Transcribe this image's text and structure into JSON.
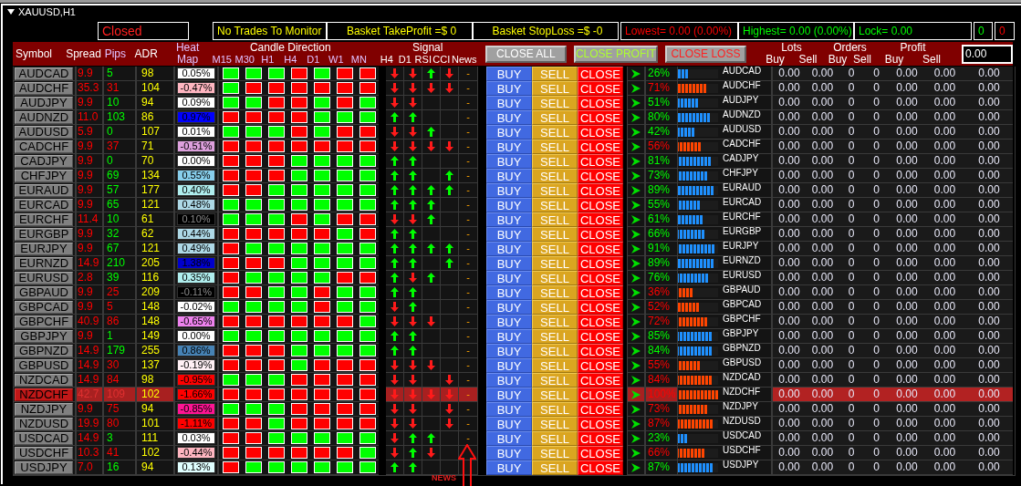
{
  "window": {
    "title": "XAUUSD,H1"
  },
  "status": {
    "state": "Closed",
    "monitor": "No Trades To Monitor",
    "basket_take_profit": "Basket TakeProfit =$ 0",
    "basket_stop_loss": "Basket StopLoss =$ -0",
    "lowest": "Lowest= 0.00 (0.00%)",
    "highest": "Highest= 0.00 (0.00%)",
    "lock": "Lock= 0.00",
    "buy_count": "0",
    "sell_count": "0"
  },
  "header": {
    "symbol": "Symbol",
    "spread": "Spread",
    "pips": "Pips",
    "adr": "ADR",
    "heat_map": "Heat Map",
    "candle_direction": {
      "title": "Candle Direction",
      "timeframes": [
        "M15",
        "M30",
        "H1",
        "H4",
        "D1",
        "W1",
        "MN"
      ]
    },
    "signal": {
      "title": "Signal",
      "columns": [
        "H4",
        "D1",
        "RSI",
        "CCI",
        "News"
      ]
    },
    "buttons": [
      {
        "label": "CLOSE ALL",
        "kind": "all"
      },
      {
        "label": "CLOSE PROFIT",
        "kind": "profit"
      },
      {
        "label": "CLOSE LOSS",
        "kind": "loss"
      }
    ],
    "groups": [
      {
        "title": "Lots",
        "columns": [
          "Buy",
          "Sell"
        ]
      },
      {
        "title": "Orders",
        "columns": [
          "Buy",
          "Sell"
        ]
      },
      {
        "title": "Profit",
        "columns": [
          "Buy",
          "Sell"
        ]
      }
    ],
    "total_field": {
      "value": "0.00"
    }
  },
  "rows": [
    {
      "symbol": "AUDCAD",
      "selected": false,
      "spread": "9.9",
      "pips": "5",
      "pips_up": true,
      "adr": "98",
      "heat": {
        "text": "0.05%",
        "color": "#ffffff"
      },
      "candles_up": [
        true,
        true,
        true,
        false,
        true,
        false,
        false
      ],
      "signals": [
        {
          "kind": "down"
        },
        {
          "kind": "down"
        },
        {
          "kind": "up"
        },
        {
          "kind": "down"
        }
      ],
      "news": "-",
      "actions": [
        "BUY",
        "SELL",
        "CLOSE"
      ],
      "strength": "26%",
      "level": 0.26,
      "bullish": true,
      "pair": "AUDCAD",
      "values": [
        "0.00",
        "0.00",
        "0",
        "0",
        "0.00",
        "0.00",
        "0.00"
      ]
    },
    {
      "symbol": "AUDCHF",
      "selected": false,
      "spread": "35.3",
      "pips": "31",
      "pips_up": false,
      "adr": "104",
      "heat": {
        "text": "-0.47%",
        "color": "#ffb6c1"
      },
      "candles_up": [
        true,
        false,
        false,
        false,
        false,
        false,
        false
      ],
      "signals": [
        {
          "kind": "down"
        },
        {
          "kind": "down"
        },
        {
          "kind": "down"
        },
        {
          "kind": "down"
        }
      ],
      "news": "-",
      "actions": [
        "BUY",
        "SELL",
        "CLOSE"
      ],
      "strength": "71%",
      "level": 0.71,
      "bullish": false,
      "pair": "AUDCHF",
      "values": [
        "0.00",
        "0.00",
        "0",
        "0",
        "0.00",
        "0.00",
        "0.00"
      ]
    },
    {
      "symbol": "AUDJPY",
      "selected": false,
      "spread": "9.9",
      "pips": "10",
      "pips_up": true,
      "adr": "94",
      "heat": {
        "text": "0.09%",
        "color": "#ffffff"
      },
      "candles_up": [
        true,
        true,
        false,
        false,
        true,
        false,
        true
      ],
      "signals": [
        {
          "kind": "down"
        },
        {
          "kind": "down"
        },
        {
          "kind": "blank"
        },
        {
          "kind": "blank"
        }
      ],
      "news": "-",
      "actions": [
        "BUY",
        "SELL",
        "CLOSE"
      ],
      "strength": "51%",
      "level": 0.51,
      "bullish": true,
      "pair": "AUDJPY",
      "values": [
        "0.00",
        "0.00",
        "0",
        "0",
        "0.00",
        "0.00",
        "0.00"
      ]
    },
    {
      "symbol": "AUDNZD",
      "selected": false,
      "spread": "11.0",
      "pips": "103",
      "pips_up": true,
      "adr": "86",
      "heat": {
        "text": "0.97%",
        "color": "#0000ff"
      },
      "candles_up": [
        false,
        false,
        false,
        false,
        true,
        true,
        true
      ],
      "signals": [
        {
          "kind": "up"
        },
        {
          "kind": "up"
        },
        {
          "kind": "blank"
        },
        {
          "kind": "blank"
        }
      ],
      "news": "-",
      "actions": [
        "BUY",
        "SELL",
        "CLOSE"
      ],
      "strength": "80%",
      "level": 0.8,
      "bullish": true,
      "pair": "AUDNZD",
      "values": [
        "0.00",
        "0.00",
        "0",
        "0",
        "0.00",
        "0.00",
        "0.00"
      ]
    },
    {
      "symbol": "AUDUSD",
      "selected": false,
      "spread": "5.9",
      "pips": "0",
      "pips_up": true,
      "adr": "107",
      "heat": {
        "text": "0.01%",
        "color": "#ffffff"
      },
      "candles_up": [
        true,
        true,
        true,
        false,
        true,
        false,
        false
      ],
      "signals": [
        {
          "kind": "down"
        },
        {
          "kind": "down"
        },
        {
          "kind": "up"
        },
        {
          "kind": "blank"
        }
      ],
      "news": "-",
      "actions": [
        "BUY",
        "SELL",
        "CLOSE"
      ],
      "strength": "42%",
      "level": 0.42,
      "bullish": true,
      "pair": "AUDUSD",
      "values": [
        "0.00",
        "0.00",
        "0",
        "0",
        "0.00",
        "0.00",
        "0.00"
      ]
    },
    {
      "symbol": "CADCHF",
      "selected": false,
      "spread": "9.9",
      "pips": "37",
      "pips_up": false,
      "adr": "71",
      "heat": {
        "text": "-0.51%",
        "color": "#dda0dd"
      },
      "candles_up": [
        false,
        false,
        false,
        false,
        false,
        false,
        false
      ],
      "signals": [
        {
          "kind": "down"
        },
        {
          "kind": "down"
        },
        {
          "kind": "down"
        },
        {
          "kind": "down"
        }
      ],
      "news": "-",
      "actions": [
        "BUY",
        "SELL",
        "CLOSE"
      ],
      "strength": "56%",
      "level": 0.56,
      "bullish": false,
      "pair": "CADCHF",
      "values": [
        "0.00",
        "0.00",
        "0",
        "0",
        "0.00",
        "0.00",
        "0.00"
      ]
    },
    {
      "symbol": "CADJPY",
      "selected": false,
      "spread": "9.9",
      "pips": "0",
      "pips_up": true,
      "adr": "70",
      "heat": {
        "text": "0.00%",
        "color": "#ffffff"
      },
      "candles_up": [
        false,
        false,
        false,
        true,
        true,
        true,
        true
      ],
      "signals": [
        {
          "kind": "up"
        },
        {
          "kind": "up"
        },
        {
          "kind": "blank"
        },
        {
          "kind": "blank"
        }
      ],
      "news": "-",
      "actions": [
        "BUY",
        "SELL",
        "CLOSE"
      ],
      "strength": "81%",
      "level": 0.81,
      "bullish": true,
      "pair": "CADJPY",
      "values": [
        "0.00",
        "0.00",
        "0",
        "0",
        "0.00",
        "0.00",
        "0.00"
      ]
    },
    {
      "symbol": "CHFJPY",
      "selected": false,
      "spread": "9.9",
      "pips": "69",
      "pips_up": true,
      "adr": "134",
      "heat": {
        "text": "0.55%",
        "color": "#87ceeb"
      },
      "candles_up": [
        false,
        false,
        false,
        true,
        true,
        true,
        true
      ],
      "signals": [
        {
          "kind": "up"
        },
        {
          "kind": "up"
        },
        {
          "kind": "blank"
        },
        {
          "kind": "up"
        }
      ],
      "news": "-",
      "actions": [
        "BUY",
        "SELL",
        "CLOSE"
      ],
      "strength": "73%",
      "level": 0.73,
      "bullish": true,
      "pair": "CHFJPY",
      "values": [
        "0.00",
        "0.00",
        "0",
        "0",
        "0.00",
        "0.00",
        "0.00"
      ]
    },
    {
      "symbol": "EURAUD",
      "selected": false,
      "spread": "9.9",
      "pips": "57",
      "pips_up": true,
      "adr": "177",
      "heat": {
        "text": "0.40%",
        "color": "#afeeee"
      },
      "candles_up": [
        false,
        false,
        true,
        true,
        true,
        true,
        true
      ],
      "signals": [
        {
          "kind": "up"
        },
        {
          "kind": "up"
        },
        {
          "kind": "up"
        },
        {
          "kind": "up"
        }
      ],
      "news": "-",
      "actions": [
        "BUY",
        "SELL",
        "CLOSE"
      ],
      "strength": "89%",
      "level": 0.89,
      "bullish": true,
      "pair": "EURAUD",
      "values": [
        "0.00",
        "0.00",
        "0",
        "0",
        "0.00",
        "0.00",
        "0.00"
      ]
    },
    {
      "symbol": "EURCAD",
      "selected": false,
      "spread": "9.9",
      "pips": "65",
      "pips_up": true,
      "adr": "121",
      "heat": {
        "text": "0.48%",
        "color": "#add8e6"
      },
      "candles_up": [
        true,
        true,
        true,
        true,
        true,
        true,
        true
      ],
      "signals": [
        {
          "kind": "up"
        },
        {
          "kind": "up"
        },
        {
          "kind": "up"
        },
        {
          "kind": "blank"
        }
      ],
      "news": "-",
      "actions": [
        "BUY",
        "SELL",
        "CLOSE"
      ],
      "strength": "55%",
      "level": 0.55,
      "bullish": true,
      "pair": "EURCAD",
      "values": [
        "0.00",
        "0.00",
        "0",
        "0",
        "0.00",
        "0.00",
        "0.00"
      ]
    },
    {
      "symbol": "EURCHF",
      "selected": false,
      "spread": "11.4",
      "pips": "10",
      "pips_up": true,
      "adr": "61",
      "heat": {
        "text": "0.10%",
        "color": "#000000"
      },
      "candles_up": [
        true,
        true,
        true,
        false,
        true,
        false,
        false
      ],
      "signals": [
        {
          "kind": "down"
        },
        {
          "kind": "down"
        },
        {
          "kind": "up"
        },
        {
          "kind": "blank"
        }
      ],
      "news": "-",
      "actions": [
        "BUY",
        "SELL",
        "CLOSE"
      ],
      "strength": "61%",
      "level": 0.61,
      "bullish": true,
      "pair": "EURCHF",
      "values": [
        "0.00",
        "0.00",
        "0",
        "0",
        "0.00",
        "0.00",
        "0.00"
      ]
    },
    {
      "symbol": "EURGBP",
      "selected": false,
      "spread": "9.9",
      "pips": "32",
      "pips_up": true,
      "adr": "62",
      "heat": {
        "text": "0.44%",
        "color": "#add8e6"
      },
      "candles_up": [
        false,
        false,
        false,
        false,
        false,
        true,
        false
      ],
      "signals": [
        {
          "kind": "up"
        },
        {
          "kind": "up"
        },
        {
          "kind": "blank"
        },
        {
          "kind": "blank"
        }
      ],
      "news": "-",
      "actions": [
        "BUY",
        "SELL",
        "CLOSE"
      ],
      "strength": "66%",
      "level": 0.66,
      "bullish": true,
      "pair": "EURGBP",
      "values": [
        "0.00",
        "0.00",
        "0",
        "0",
        "0.00",
        "0.00",
        "0.00"
      ]
    },
    {
      "symbol": "EURJPY",
      "selected": false,
      "spread": "9.9",
      "pips": "67",
      "pips_up": true,
      "adr": "121",
      "heat": {
        "text": "0.49%",
        "color": "#add8e6"
      },
      "candles_up": [
        false,
        true,
        true,
        true,
        true,
        true,
        true
      ],
      "signals": [
        {
          "kind": "up"
        },
        {
          "kind": "up"
        },
        {
          "kind": "up"
        },
        {
          "kind": "up"
        }
      ],
      "news": "-",
      "actions": [
        "BUY",
        "SELL",
        "CLOSE"
      ],
      "strength": "91%",
      "level": 0.91,
      "bullish": true,
      "pair": "EURJPY",
      "values": [
        "0.00",
        "0.00",
        "0",
        "0",
        "0.00",
        "0.00",
        "0.00"
      ]
    },
    {
      "symbol": "EURNZD",
      "selected": false,
      "spread": "14.9",
      "pips": "210",
      "pips_up": true,
      "adr": "205",
      "heat": {
        "text": "1.38%",
        "color": "#0000cd"
      },
      "candles_up": [
        false,
        false,
        false,
        true,
        true,
        true,
        true
      ],
      "signals": [
        {
          "kind": "up"
        },
        {
          "kind": "up"
        },
        {
          "kind": "blank"
        },
        {
          "kind": "up"
        }
      ],
      "news": "-",
      "actions": [
        "BUY",
        "SELL",
        "CLOSE"
      ],
      "strength": "89%",
      "level": 0.89,
      "bullish": true,
      "pair": "EURNZD",
      "values": [
        "0.00",
        "0.00",
        "0",
        "0",
        "0.00",
        "0.00",
        "0.00"
      ]
    },
    {
      "symbol": "EURUSD",
      "selected": false,
      "spread": "2.8",
      "pips": "39",
      "pips_up": true,
      "adr": "116",
      "heat": {
        "text": "0.35%",
        "color": "#afeeee"
      },
      "candles_up": [
        false,
        true,
        true,
        true,
        true,
        false,
        false
      ],
      "signals": [
        {
          "kind": "up"
        },
        {
          "kind": "down"
        },
        {
          "kind": "up"
        },
        {
          "kind": "blank"
        }
      ],
      "news": "-",
      "actions": [
        "BUY",
        "SELL",
        "CLOSE"
      ],
      "strength": "76%",
      "level": 0.76,
      "bullish": true,
      "pair": "EURUSD",
      "values": [
        "0.00",
        "0.00",
        "0",
        "0",
        "0.00",
        "0.00",
        "0.00"
      ]
    },
    {
      "symbol": "GBPAUD",
      "selected": false,
      "spread": "9.9",
      "pips": "25",
      "pips_up": false,
      "adr": "209",
      "heat": {
        "text": "-0.11%",
        "color": "#000000"
      },
      "candles_up": [
        false,
        false,
        true,
        true,
        false,
        true,
        true
      ],
      "signals": [
        {
          "kind": "up"
        },
        {
          "kind": "up"
        },
        {
          "kind": "blank"
        },
        {
          "kind": "blank"
        }
      ],
      "news": "-",
      "actions": [
        "BUY",
        "SELL",
        "CLOSE"
      ],
      "strength": "36%",
      "level": 0.36,
      "bullish": false,
      "pair": "GBPAUD",
      "values": [
        "0.00",
        "0.00",
        "0",
        "0",
        "0.00",
        "0.00",
        "0.00"
      ]
    },
    {
      "symbol": "GBPCAD",
      "selected": false,
      "spread": "9.9",
      "pips": "5",
      "pips_up": false,
      "adr": "148",
      "heat": {
        "text": "-0.02%",
        "color": "#ffffff"
      },
      "candles_up": [
        true,
        true,
        true,
        true,
        false,
        true,
        true
      ],
      "signals": [
        {
          "kind": "down"
        },
        {
          "kind": "up"
        },
        {
          "kind": "blank"
        },
        {
          "kind": "blank"
        }
      ],
      "news": "-",
      "actions": [
        "BUY",
        "SELL",
        "CLOSE"
      ],
      "strength": "52%",
      "level": 0.52,
      "bullish": false,
      "pair": "GBPCAD",
      "values": [
        "0.00",
        "0.00",
        "0",
        "0",
        "0.00",
        "0.00",
        "0.00"
      ]
    },
    {
      "symbol": "GBPCHF",
      "selected": false,
      "spread": "40.9",
      "pips": "86",
      "pips_up": false,
      "adr": "148",
      "heat": {
        "text": "-0.65%",
        "color": "#ee82ee"
      },
      "candles_up": [
        false,
        false,
        false,
        false,
        false,
        false,
        true
      ],
      "signals": [
        {
          "kind": "down"
        },
        {
          "kind": "down"
        },
        {
          "kind": "down"
        },
        {
          "kind": "blank"
        }
      ],
      "news": "-",
      "actions": [
        "BUY",
        "SELL",
        "CLOSE"
      ],
      "strength": "72%",
      "level": 0.72,
      "bullish": false,
      "pair": "GBPCHF",
      "values": [
        "0.00",
        "0.00",
        "0",
        "0",
        "0.00",
        "0.00",
        "0.00"
      ]
    },
    {
      "symbol": "GBPJPY",
      "selected": false,
      "spread": "9.9",
      "pips": "1",
      "pips_up": true,
      "adr": "149",
      "heat": {
        "text": "0.00%",
        "color": "#ffffff"
      },
      "candles_up": [
        true,
        true,
        true,
        true,
        true,
        true,
        true
      ],
      "signals": [
        {
          "kind": "up"
        },
        {
          "kind": "up"
        },
        {
          "kind": "blank"
        },
        {
          "kind": "blank"
        }
      ],
      "news": "-",
      "actions": [
        "BUY",
        "SELL",
        "CLOSE"
      ],
      "strength": "85%",
      "level": 0.85,
      "bullish": true,
      "pair": "GBPJPY",
      "values": [
        "0.00",
        "0.00",
        "0",
        "0",
        "0.00",
        "0.00",
        "0.00"
      ]
    },
    {
      "symbol": "GBPNZD",
      "selected": false,
      "spread": "14.9",
      "pips": "179",
      "pips_up": true,
      "adr": "255",
      "heat": {
        "text": "0.86%",
        "color": "#4682b4"
      },
      "candles_up": [
        false,
        false,
        false,
        true,
        true,
        true,
        true
      ],
      "signals": [
        {
          "kind": "up"
        },
        {
          "kind": "up"
        },
        {
          "kind": "blank"
        },
        {
          "kind": "blank"
        }
      ],
      "news": "-",
      "actions": [
        "BUY",
        "SELL",
        "CLOSE"
      ],
      "strength": "84%",
      "level": 0.84,
      "bullish": true,
      "pair": "GBPNZD",
      "values": [
        "0.00",
        "0.00",
        "0",
        "0",
        "0.00",
        "0.00",
        "0.00"
      ]
    },
    {
      "symbol": "GBPUSD",
      "selected": false,
      "spread": "14.9",
      "pips": "30",
      "pips_up": false,
      "adr": "137",
      "heat": {
        "text": "-0.19%",
        "color": "#fff0f5"
      },
      "candles_up": [
        false,
        false,
        false,
        true,
        false,
        false,
        false
      ],
      "signals": [
        {
          "kind": "down"
        },
        {
          "kind": "down"
        },
        {
          "kind": "down"
        },
        {
          "kind": "blank"
        }
      ],
      "news": "-",
      "actions": [
        "BUY",
        "SELL",
        "CLOSE"
      ],
      "strength": "55%",
      "level": 0.55,
      "bullish": false,
      "pair": "GBPUSD",
      "values": [
        "0.00",
        "0.00",
        "0",
        "0",
        "0.00",
        "0.00",
        "0.00"
      ]
    },
    {
      "symbol": "NZDCAD",
      "selected": false,
      "spread": "14.9",
      "pips": "84",
      "pips_up": false,
      "adr": "98",
      "heat": {
        "text": "-0.95%",
        "color": "#ff0000"
      },
      "candles_up": [
        true,
        true,
        true,
        false,
        false,
        false,
        false
      ],
      "signals": [
        {
          "kind": "down"
        },
        {
          "kind": "down"
        },
        {
          "kind": "blank"
        },
        {
          "kind": "down"
        }
      ],
      "news": "-",
      "actions": [
        "BUY",
        "SELL",
        "CLOSE"
      ],
      "strength": "84%",
      "level": 0.84,
      "bullish": false,
      "pair": "NZDCAD",
      "values": [
        "0.00",
        "0.00",
        "0",
        "0",
        "0.00",
        "0.00",
        "0.00"
      ]
    },
    {
      "symbol": "NZDCHF",
      "selected": true,
      "spread": "42.7",
      "pips": "109",
      "pips_up": false,
      "adr": "102",
      "heat": {
        "text": "-1.66%",
        "color": "#ff0000"
      },
      "candles_up": [
        false,
        false,
        false,
        false,
        false,
        false,
        false
      ],
      "signals": [
        {
          "kind": "down"
        },
        {
          "kind": "down"
        },
        {
          "kind": "down"
        },
        {
          "kind": "down"
        }
      ],
      "news": "-",
      "actions": [
        "BUY",
        "SELL",
        "CLOSE"
      ],
      "strength": "100%",
      "level": 1.0,
      "bullish": false,
      "pair": "NZDCHF",
      "values": [
        "0.00",
        "0.00",
        "0",
        "0",
        "0.00",
        "0.00",
        "0.00"
      ]
    },
    {
      "symbol": "NZDJPY",
      "selected": false,
      "spread": "9.9",
      "pips": "75",
      "pips_up": false,
      "adr": "94",
      "heat": {
        "text": "-0.85%",
        "color": "#ff1493"
      },
      "candles_up": [
        true,
        true,
        true,
        false,
        false,
        false,
        false
      ],
      "signals": [
        {
          "kind": "down"
        },
        {
          "kind": "down"
        },
        {
          "kind": "blank"
        },
        {
          "kind": "down"
        }
      ],
      "news": "-",
      "actions": [
        "BUY",
        "SELL",
        "CLOSE"
      ],
      "strength": "73%",
      "level": 0.73,
      "bullish": false,
      "pair": "NZDJPY",
      "values": [
        "0.00",
        "0.00",
        "0",
        "0",
        "0.00",
        "0.00",
        "0.00"
      ]
    },
    {
      "symbol": "NZDUSD",
      "selected": false,
      "spread": "19.9",
      "pips": "80",
      "pips_up": false,
      "adr": "101",
      "heat": {
        "text": "-1.11%",
        "color": "#ff0000"
      },
      "candles_up": [
        false,
        false,
        true,
        false,
        false,
        false,
        false
      ],
      "signals": [
        {
          "kind": "down"
        },
        {
          "kind": "down"
        },
        {
          "kind": "blank"
        },
        {
          "kind": "down"
        }
      ],
      "news": "-",
      "actions": [
        "BUY",
        "SELL",
        "CLOSE"
      ],
      "strength": "87%",
      "level": 0.87,
      "bullish": false,
      "pair": "NZDUSD",
      "values": [
        "0.00",
        "0.00",
        "0",
        "0",
        "0.00",
        "0.00",
        "0.00"
      ]
    },
    {
      "symbol": "USDCAD",
      "selected": false,
      "spread": "14.9",
      "pips": "3",
      "pips_up": true,
      "adr": "111",
      "heat": {
        "text": "0.03%",
        "color": "#ffffff"
      },
      "candles_up": [
        false,
        false,
        true,
        true,
        true,
        true,
        true
      ],
      "signals": [
        {
          "kind": "down"
        },
        {
          "kind": "up"
        },
        {
          "kind": "up"
        },
        {
          "kind": "blank"
        }
      ],
      "news": "-",
      "actions": [
        "BUY",
        "SELL",
        "CLOSE"
      ],
      "strength": "23%",
      "level": 0.23,
      "bullish": true,
      "pair": "USDCAD",
      "values": [
        "0.00",
        "0.00",
        "0",
        "0",
        "0.00",
        "0.00",
        "0.00"
      ]
    },
    {
      "symbol": "USDCHF",
      "selected": false,
      "spread": "10.3",
      "pips": "41",
      "pips_up": false,
      "adr": "102",
      "heat": {
        "text": "-0.44%",
        "color": "#ffb6c1"
      },
      "candles_up": [
        false,
        false,
        false,
        false,
        false,
        false,
        true
      ],
      "signals": [
        {
          "kind": "down"
        },
        {
          "kind": "up"
        },
        {
          "kind": "down"
        },
        {
          "kind": "blank"
        }
      ],
      "actions": [
        "BUY",
        "SELL",
        "CLOSE"
      ],
      "strength": "66%",
      "level": 0.66,
      "bullish": false,
      "pair": "USDCHF",
      "values": [
        "0.00",
        "0.00",
        "0",
        "0",
        "0.00",
        "0.00",
        "0.00"
      ]
    },
    {
      "symbol": "USDJPY",
      "selected": false,
      "spread": "7.0",
      "pips": "16",
      "pips_up": true,
      "adr": "94",
      "heat": {
        "text": "0.13%",
        "color": "#e0ffff"
      },
      "candles_up": [
        false,
        true,
        true,
        true,
        true,
        true,
        true
      ],
      "signals": [
        {
          "kind": "up"
        },
        {
          "kind": "up"
        },
        {
          "kind": "blank"
        },
        {
          "kind": "blank"
        }
      ],
      "actions": [
        "BUY",
        "SELL",
        "CLOSE"
      ],
      "strength": "87%",
      "level": 0.87,
      "bullish": true,
      "pair": "USDJPY",
      "values": [
        "0.00",
        "0.00",
        "0",
        "0",
        "0.00",
        "0.00",
        "0.00"
      ]
    }
  ],
  "annotation": {
    "label": "NEWS"
  }
}
